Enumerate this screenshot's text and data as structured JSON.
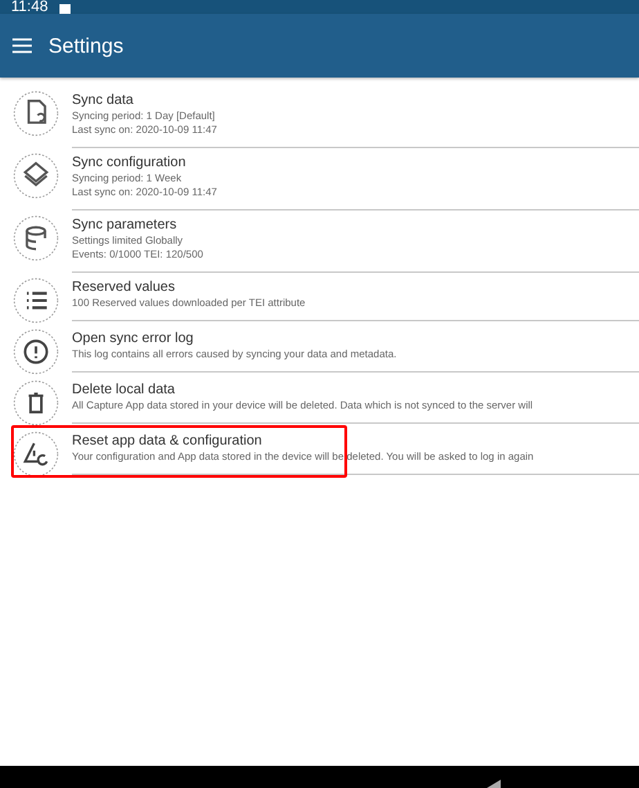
{
  "status_bar": {
    "time": "11:48"
  },
  "app_bar": {
    "title": "Settings"
  },
  "items": [
    {
      "kind": "sync-data",
      "title": "Sync data",
      "lines": [
        "Syncing period: 1 Day [Default]",
        "Last sync on: 2020-10-09 11:47"
      ],
      "highlighted": false
    },
    {
      "kind": "sync-config",
      "title": "Sync configuration",
      "lines": [
        "Syncing period: 1 Week",
        "Last sync on: 2020-10-09 11:47"
      ],
      "highlighted": false
    },
    {
      "kind": "sync-params",
      "title": "Sync parameters",
      "lines": [
        "Settings limited Globally",
        "Events: 0/1000 TEI: 120/500"
      ],
      "highlighted": false
    },
    {
      "kind": "reserved",
      "title": "Reserved values",
      "lines": [
        "100 Reserved values downloaded per TEI attribute"
      ],
      "highlighted": false
    },
    {
      "kind": "error-log",
      "title": "Open sync error log",
      "lines": [
        "This log contains all errors caused by syncing your data and metadata."
      ],
      "highlighted": false
    },
    {
      "kind": "delete",
      "title": "Delete local data",
      "lines": [
        "All Capture App data stored in your device will be deleted. Data which is not synced to the server will"
      ],
      "highlighted": false
    },
    {
      "kind": "reset",
      "title": "Reset app data & configuration",
      "lines": [
        "Your configuration and App data stored in the device will be deleted. You will be asked to log in again"
      ],
      "highlighted": true
    }
  ]
}
